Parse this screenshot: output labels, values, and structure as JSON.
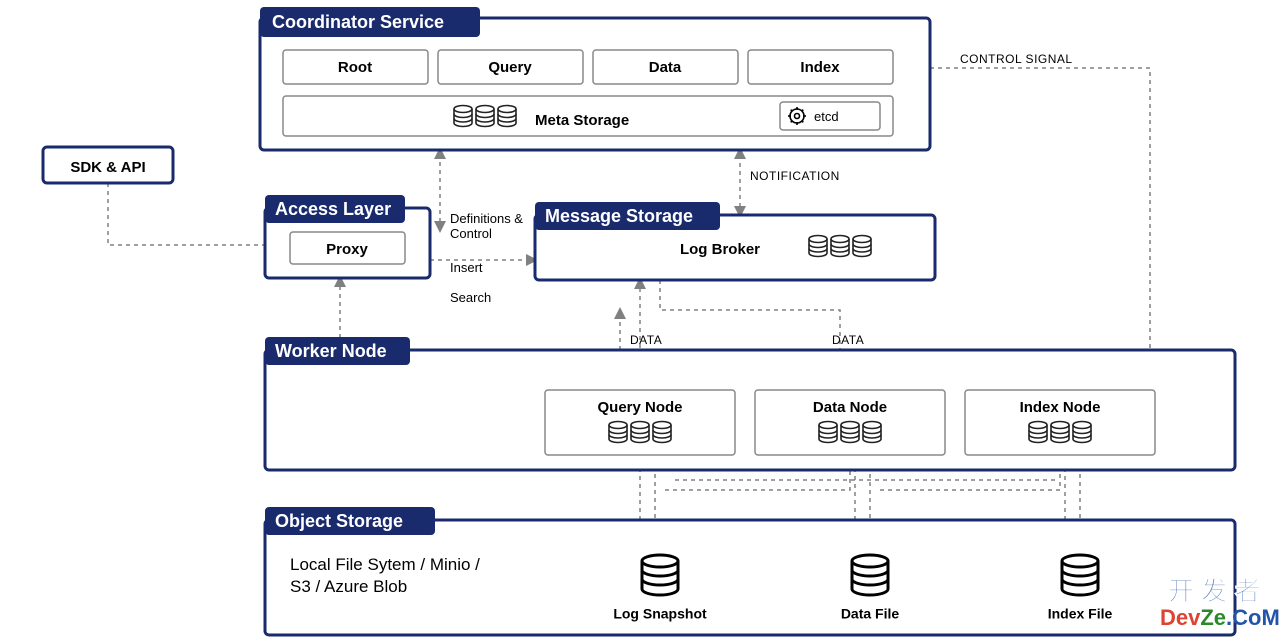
{
  "sdk": {
    "label": "SDK & API"
  },
  "coordinator": {
    "title": "Coordinator Service",
    "tabs": [
      "Root",
      "Query",
      "Data",
      "Index"
    ],
    "meta": "Meta Storage",
    "etcd": "etcd"
  },
  "access": {
    "title": "Access Layer",
    "proxy": "Proxy"
  },
  "message": {
    "title": "Message Storage",
    "broker": "Log Broker"
  },
  "worker": {
    "title": "Worker Node",
    "query": "Query Node",
    "data": "Data Node",
    "index": "Index Node"
  },
  "object": {
    "title": "Object Storage",
    "desc1": "Local File Sytem / Minio /",
    "desc2": "S3 / Azure Blob",
    "log": "Log Snapshot",
    "dataf": "Data File",
    "indexf": "Index File"
  },
  "edges": {
    "control_signal": "CONTROL SIGNAL",
    "notification": "NOTIFICATION",
    "data": "DATA",
    "defs": "Definitions &",
    "control": "Control",
    "insert": "Insert",
    "search": "Search"
  },
  "watermark": {
    "top": "开 发 者",
    "bottom": "DevZe.CoM"
  }
}
